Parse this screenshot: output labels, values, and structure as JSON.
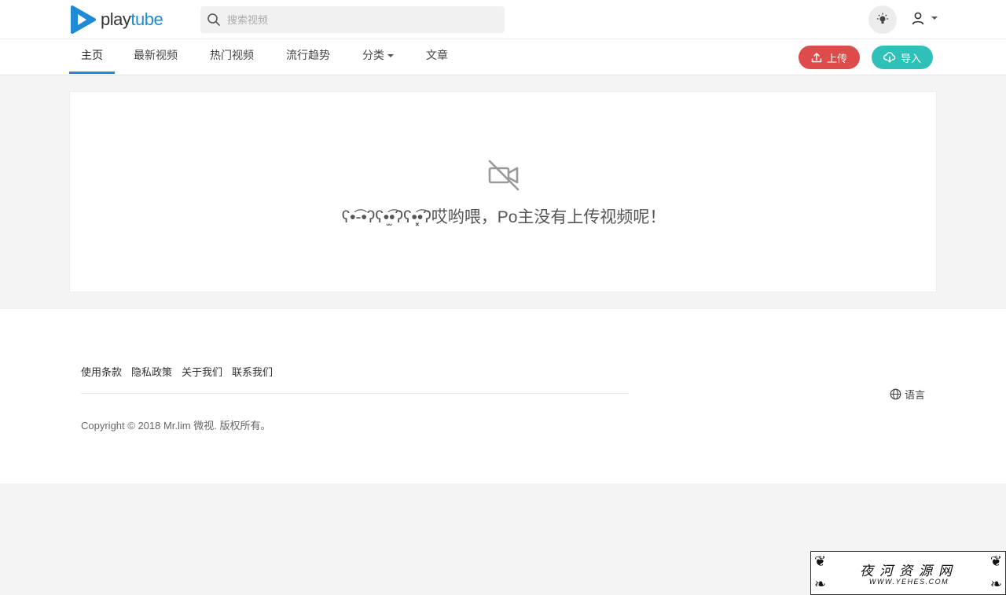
{
  "brand": {
    "logo_part1": "play",
    "logo_part2": "tube",
    "accent": "#1e8bd4"
  },
  "search": {
    "placeholder": "搜索视频"
  },
  "nav": {
    "items": [
      {
        "label": "主页"
      },
      {
        "label": "最新视频"
      },
      {
        "label": "热门视频"
      },
      {
        "label": "流行趋势"
      },
      {
        "label": "分类"
      },
      {
        "label": "文章"
      }
    ]
  },
  "actions": {
    "upload_label": "上传",
    "upload_color": "#de4b4b",
    "import_label": "导入",
    "import_color": "#2fc0b8"
  },
  "empty_state": {
    "icon": "video-off-icon",
    "message": "ʕ•͡-•ʔʕ•̫͡•ʔʕ•͓͡•ʔ哎哟喂，Po主没有上传视频呢！"
  },
  "footer": {
    "links": [
      "使用条款",
      "隐私政策",
      "关于我们",
      "联系我们"
    ],
    "copyright": "Copyright © 2018 Mr.lim 微视. 版权所有。",
    "language_label": "语言"
  },
  "watermark": {
    "title": "夜河资源网",
    "url": "WWW.YEHES.COM"
  }
}
